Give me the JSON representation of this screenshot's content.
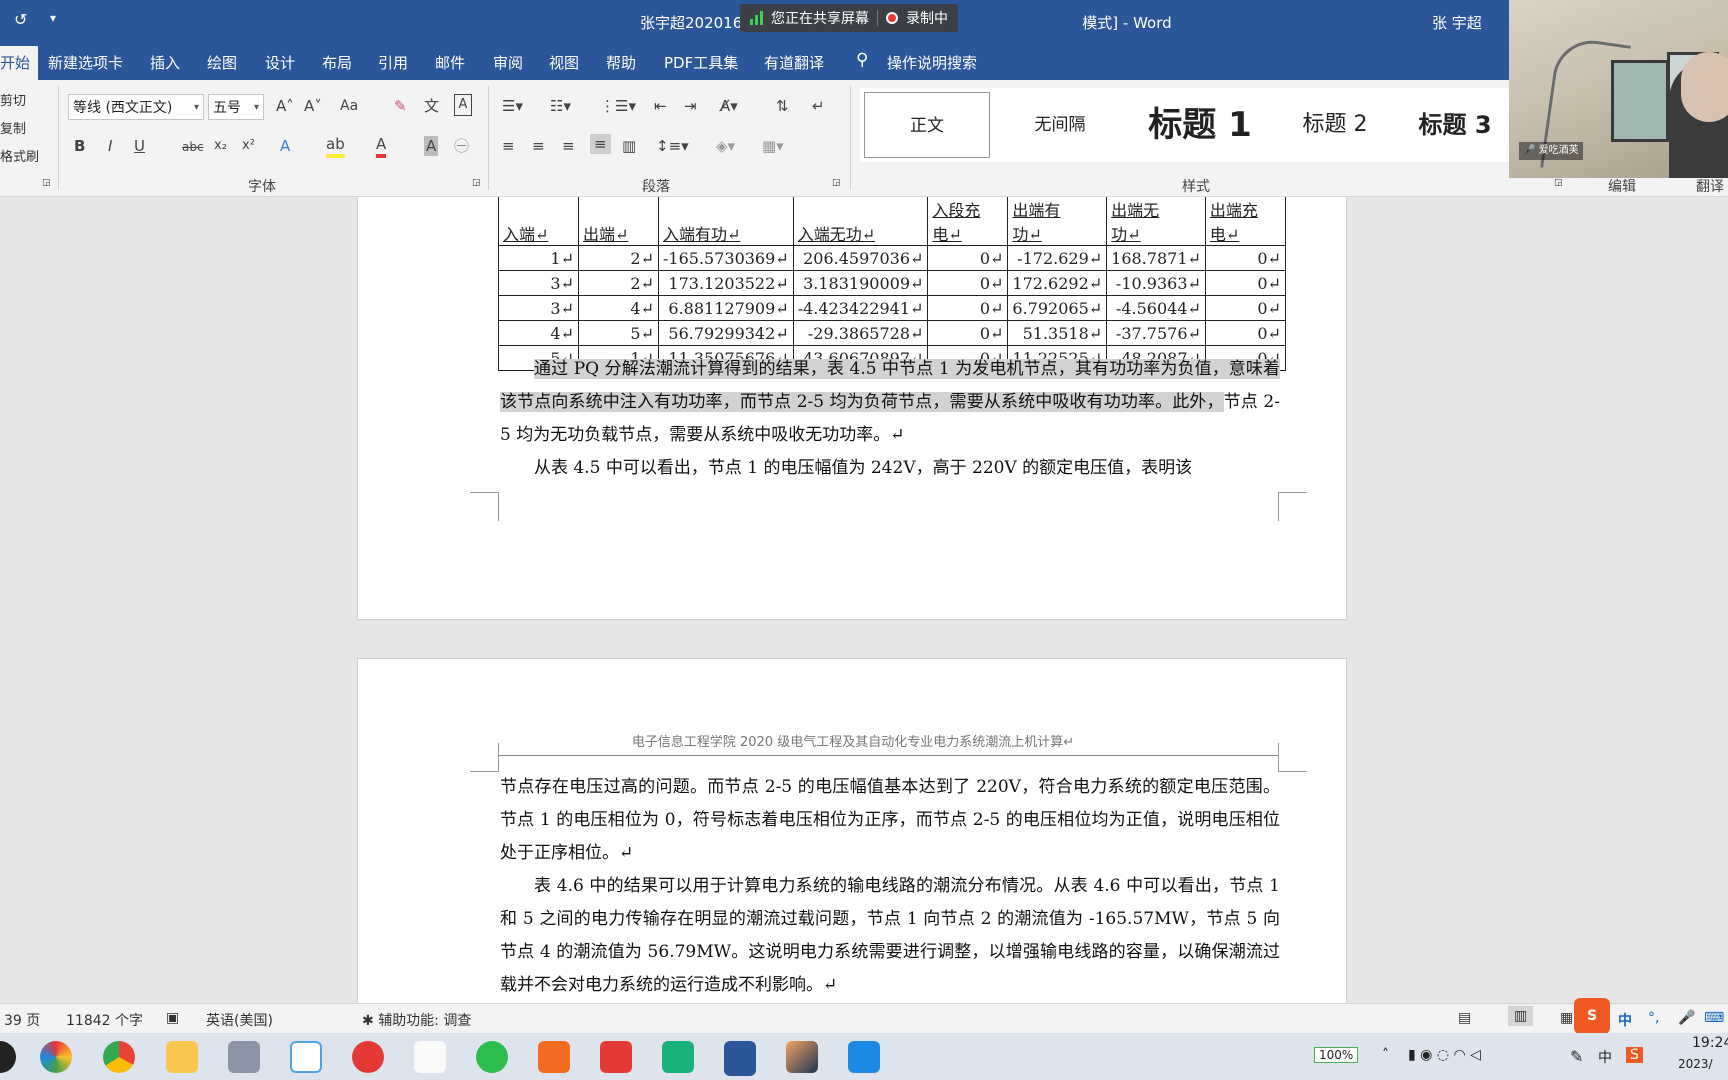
{
  "titlebar": {
    "doc_title": "张宇超20201б… [兼容模式] - Word",
    "doc_title_left": "张宇超202016",
    "doc_title_right": "模式]  -  Word",
    "share_text": "您正在共享屏幕",
    "rec_text": "录制中",
    "user": "张 宇超"
  },
  "tabs": [
    "开始",
    "新建选项卡",
    "插入",
    "绘图",
    "设计",
    "布局",
    "引用",
    "邮件",
    "审阅",
    "视图",
    "帮助",
    "PDF工具集",
    "有道翻译",
    "操作说明搜索"
  ],
  "clipboard": {
    "cut": "剪切",
    "copy": "复制",
    "format_painter": "格式刷"
  },
  "font": {
    "family": "等线 (西文正文)",
    "size": "五号",
    "group_label": "字体",
    "case_btn": "Aa",
    "bold": "B",
    "italic": "I",
    "underline": "U",
    "strike": "abc",
    "sub": "x₂",
    "sup": "x²"
  },
  "paragraph": {
    "group_label": "段落"
  },
  "styles": {
    "group_label": "样式",
    "normal": "正文",
    "no_spacing": "无间隔",
    "h1": "标题 1",
    "h2": "标题 2",
    "h3": "标题 3"
  },
  "right_groups": {
    "edit": "编辑",
    "translate": "翻译"
  },
  "webcam": {
    "caption": "爱吃酒芙"
  },
  "table": {
    "headers": [
      "入端",
      "出端",
      "入端有功",
      "入端无功",
      "入段充电",
      "出端有功",
      "出端无功",
      "出端充电"
    ],
    "header_visible": [
      "入端↵",
      "出端↵",
      "入端有功↵",
      "入端无功↵",
      "入段充\n电↵",
      "出端有\n功↵",
      "出端无\n功↵",
      "出端充\n电↵"
    ],
    "rows": [
      [
        "1↵",
        "2↵",
        "-165.5730369↵",
        "206.4597036↵",
        "0↵",
        "-172.629↵",
        "168.7871↵",
        "0↵"
      ],
      [
        "3↵",
        "2↵",
        "173.1203522↵",
        "3.183190009↵",
        "0↵",
        "172.6292↵",
        "-10.9363↵",
        "0↵"
      ],
      [
        "3↵",
        "4↵",
        "6.881127909↵",
        "-4.423422941↵",
        "0↵",
        "6.792065↵",
        "-4.56044↵",
        "0↵"
      ],
      [
        "4↵",
        "5↵",
        "56.79299342↵",
        "-29.3865728↵",
        "0↵",
        "51.3518↵",
        "-37.7576↵",
        "0↵"
      ],
      [
        "5↵",
        "1↵",
        "11.35075676↵",
        "-43.60670897↵",
        "0↵",
        "11.22525↵",
        "-48.2087↵",
        "0↵"
      ]
    ]
  },
  "page1": {
    "para1_hl": "通过 PQ 分解法潮流计算得到的结果，表 4.5 中节点 1 为发电机节点，其有功功率为负值，意味着该节点向系统中注入有功功率，而节点 2-5 均为负荷节点，需要从系统中吸收有功功率。此外，",
    "para1_rest": "节点 2-5 均为无功负载节点，需要从系统中吸收无功功率。↵",
    "para2": "从表 4.5 中可以看出，节点 1 的电压幅值为 242V，高于 220V 的额定电压值，表明该"
  },
  "page2": {
    "header": "电子信息工程学院 2020 级电气工程及其自动化专业电力系统潮流上机计算↵",
    "para1": "节点存在电压过高的问题。而节点 2-5 的电压幅值基本达到了 220V，符合电力系统的额定电压范围。节点 1 的电压相位为 0，符号标志着电压相位为正序，而节点 2-5 的电压相位均为正值，说明电压相位处于正序相位。↵",
    "para2": "表 4.6 中的结果可以用于计算电力系统的输电线路的潮流分布情况。从表 4.6 中可以看出，节点 1 和 5 之间的电力传输存在明显的潮流过载问题，节点 1 向节点 2 的潮流值为 -165.57MW，节点 5 向节点 4 的潮流值为 56.79MW。这说明电力系统需要进行调整，以增强输电线路的容量，以确保潮流过载并不会对电力系统的运行造成不利影响。↵"
  },
  "status": {
    "pages": "39 页",
    "words": "11842 个字",
    "language": "英语(美国)",
    "accessibility": "辅助功能: 调查"
  },
  "taskbar": {
    "battery": "100%",
    "ime": "中",
    "time": "19:24",
    "date": "2023/"
  }
}
